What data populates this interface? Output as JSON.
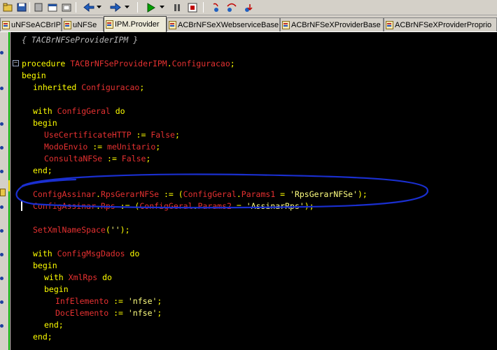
{
  "toolbar": {
    "buttons": [
      "open-icon",
      "save-icon",
      "save-all-icon",
      "new-form-icon",
      "toggle-icon",
      "back-icon",
      "forward-icon",
      "run-icon",
      "pause-icon",
      "stop-icon",
      "step-into-icon",
      "step-over-icon",
      "trace-icon"
    ],
    "colors": {
      "run": "#00a000",
      "stop": "#c00000",
      "nav": "#2060c0"
    }
  },
  "tabs": [
    {
      "label": "uNFSeACBrIPM",
      "active": false
    },
    {
      "label": "uNFSe",
      "active": false
    },
    {
      "label": "IPM.Provider",
      "active": true
    },
    {
      "label": "ACBrNFSeXWebserviceBase",
      "active": false
    },
    {
      "label": "ACBrNFSeXProviderBase",
      "active": false
    },
    {
      "label": "ACBrNFSeXProviderProprio",
      "active": false
    }
  ],
  "code": {
    "lines": [
      "{ TACBrNFSeProviderIPM }",
      "",
      "procedure TACBrNFSeProviderIPM.Configuracao;",
      "begin",
      "inherited Configuracao;",
      "",
      "with ConfigGeral do",
      "begin",
      "UseCertificateHTTP := False;",
      "ModoEnvio := meUnitario;",
      "ConsultaNFSe := False;",
      "end;",
      "",
      "ConfigAssinar.RpsGerarNFSe := (ConfigGeral.Params1 = 'RpsGerarNFSe');",
      "ConfigAssinar.Rps := (ConfigGeral.Params2 = 'AssinarRps');",
      "",
      "SetXmlNameSpace('');",
      "",
      "with ConfigMsgDados do",
      "begin",
      "with XmlRps do",
      "begin",
      "InfElemento := 'nfse';",
      "DocElemento := 'nfse';",
      "end;",
      "end;"
    ]
  },
  "colors": {
    "background": "#000000",
    "keyword": "#ffff00",
    "identifier": "#e63131",
    "string": "#ffff80",
    "comment": "#b8b8b8",
    "annotation": "#1a2fd0"
  }
}
